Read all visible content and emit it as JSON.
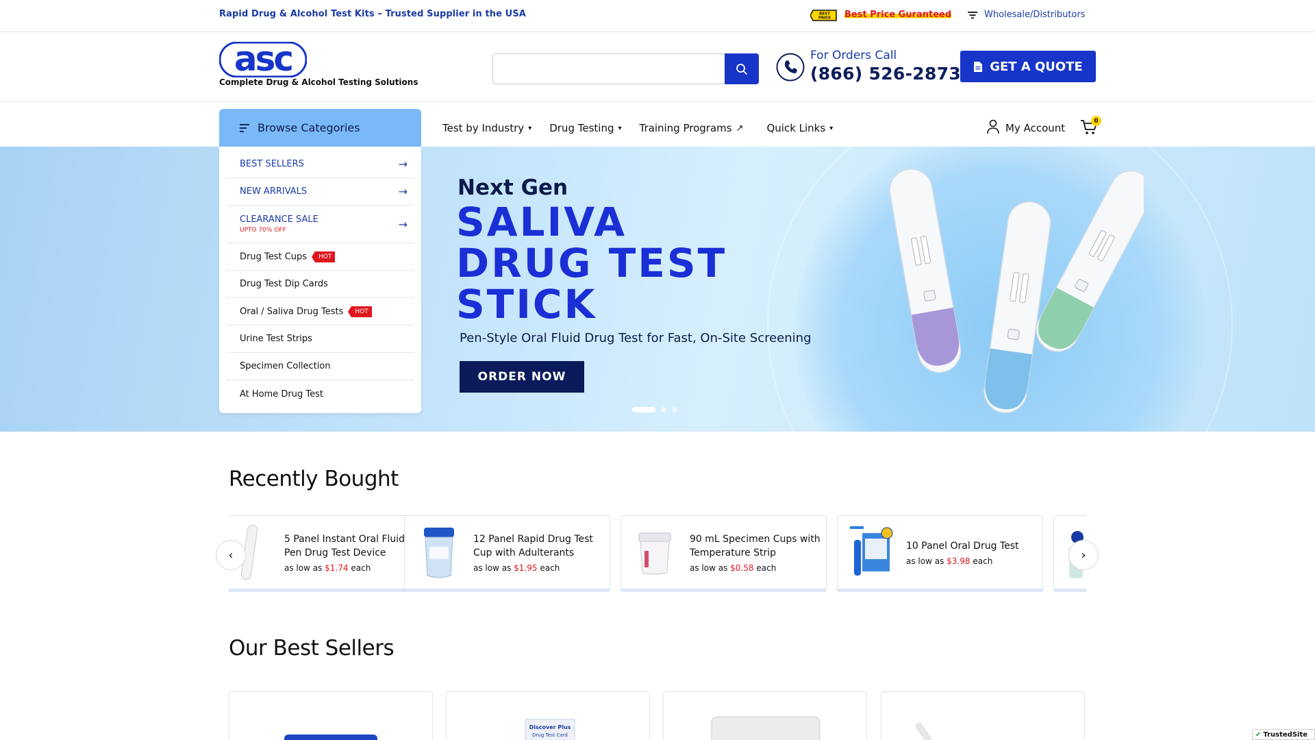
{
  "topbar": {
    "tagline": "Rapid Drug & Alcohol Test Kits – Trusted Supplier in the USA",
    "best_badge": "BEST PRICE",
    "best_price": "Best Price Guranteed",
    "wholesale": "Wholesale/Distributors"
  },
  "header": {
    "logo_text": "asc",
    "logo_tagline": "Complete Drug & Alcohol Testing Solutions",
    "search_placeholder": "",
    "orders_label": "For Orders Call",
    "orders_phone": "(866) 526-2873",
    "quote_label": "GET A QUOTE",
    "accent": "#1735c8"
  },
  "nav": {
    "browse_label": "Browse Categories",
    "items": [
      {
        "label": "Test by Industry",
        "icon": "caret-down-icon"
      },
      {
        "label": "Drug Testing",
        "icon": "caret-down-icon"
      },
      {
        "label": "Training Programs",
        "icon": "external-arrow-icon"
      },
      {
        "label": "Quick Links",
        "icon": "caret-down-icon"
      }
    ],
    "account_label": "My Account",
    "cart_count": "0"
  },
  "categories": [
    {
      "label": "BEST SELLERS",
      "style": "blue",
      "arrow": "→"
    },
    {
      "label": "NEW ARRIVALS",
      "style": "blue",
      "arrow": "→"
    },
    {
      "label": "CLEARANCE SALE",
      "sub": "UPTO 70% OFF",
      "style": "blue",
      "arrow": "→"
    },
    {
      "label": "Drug Test Cups",
      "hot": "HOT"
    },
    {
      "label": "Drug Test Dip Cards"
    },
    {
      "label": "Oral / Saliva Drug Tests",
      "hot": "HOT"
    },
    {
      "label": "Urine Test Strips"
    },
    {
      "label": "Specimen Collection"
    },
    {
      "label": "At Home Drug Test"
    }
  ],
  "hero": {
    "small": "Next Gen",
    "line1": "SALIVA",
    "line2": "DRUG TEST",
    "line3": "STICK",
    "sub": "Pen-Style Oral Fluid Drug Test for Fast, On-Site Screening",
    "button": "ORDER NOW",
    "slide_count": 3,
    "active_slide": 1
  },
  "recently_bought": {
    "title": "Recently Bought",
    "items": [
      {
        "name": "5 Panel Instant Oral Fluid Pen Drug Test Device",
        "price_prefix": "as low as",
        "price": "$1.74",
        "price_suffix": "each"
      },
      {
        "name": "12 Panel Rapid Drug Test Cup with Adulterants",
        "price_prefix": "as low as",
        "price": "$1.95",
        "price_suffix": "each"
      },
      {
        "name": "90 mL Specimen Cups with Temperature Strip",
        "price_prefix": "as low as",
        "price": "$0.58",
        "price_suffix": "each"
      },
      {
        "name": "10 Panel Oral Drug Test",
        "price_prefix": "as low as",
        "price": "$3.98",
        "price_suffix": "each"
      }
    ],
    "prev": "‹",
    "next": "›"
  },
  "best_sellers": {
    "title": "Our Best Sellers",
    "card2_brand": "Discover Plus",
    "card2_text": "Drug Test Card"
  },
  "trusted": "TrustedSite"
}
